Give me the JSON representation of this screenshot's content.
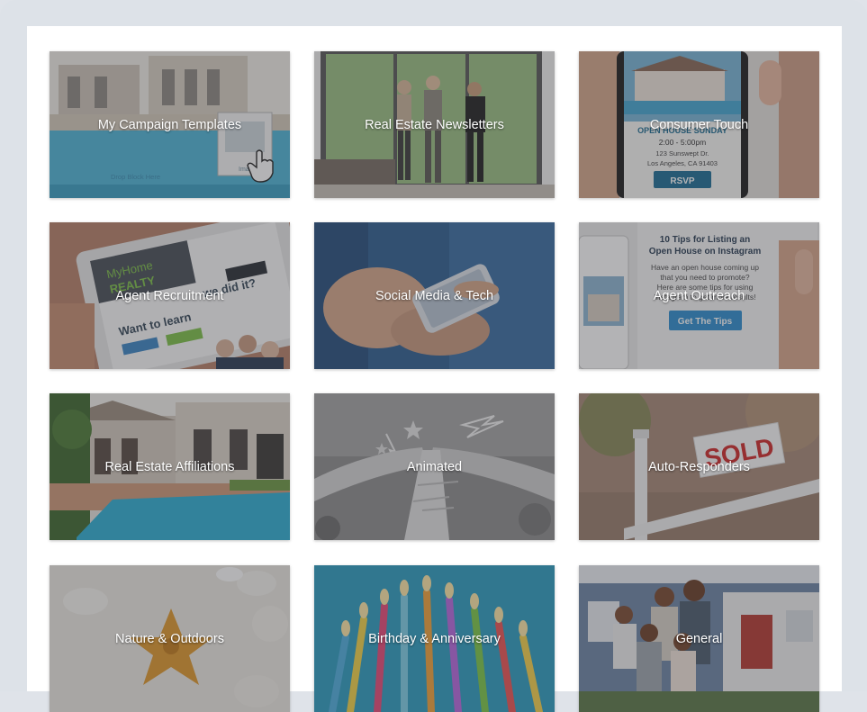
{
  "gallery": {
    "cards": [
      {
        "label": "My Campaign Templates",
        "image_note": "Drop Block Here",
        "image_note2": "Imag"
      },
      {
        "label": "Real Estate Newsletters"
      },
      {
        "label": "Consumer Touch",
        "image_line1": "OPEN HOUSE SUNDAY",
        "image_line2": "2:00 - 5:00pm",
        "image_line3": "123 Sunswept Dr.",
        "image_line4": "Los Angeles, CA 91403",
        "image_button": "RSVP"
      },
      {
        "label": "Agent Recruitment",
        "image_brand1": "MyHome",
        "image_brand2": "REALTY",
        "image_headline": "we did it?",
        "image_cta": "Want to learn"
      },
      {
        "label": "Social Media & Tech"
      },
      {
        "label": "Agent Outreach",
        "image_title1": "10 Tips for Listing an",
        "image_title2": "Open House on Instagram",
        "image_body1": "Have an open house coming up",
        "image_body2": "that you need to promote?",
        "image_body3": "Here are some tips for using",
        "image_body4": "Instagram to get more results!",
        "image_button": "Get The Tips"
      },
      {
        "label": "Real Estate Affiliations"
      },
      {
        "label": "Animated"
      },
      {
        "label": "Auto-Responders",
        "image_sign": "SOLD"
      },
      {
        "label": "Nature & Outdoors"
      },
      {
        "label": "Birthday & Anniversary"
      },
      {
        "label": "General"
      }
    ]
  }
}
